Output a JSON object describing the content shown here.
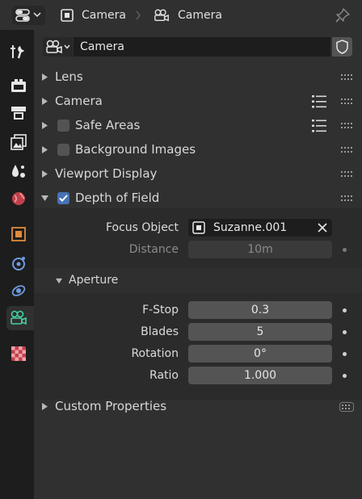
{
  "header": {
    "editor_type_icon": "properties-editor-icon",
    "breadcrumb": [
      {
        "icon": "object-icon",
        "label": "Camera"
      },
      {
        "icon": "camera-data-icon",
        "label": "Camera"
      }
    ],
    "pin_icon": "pin-icon"
  },
  "tabs": [
    {
      "icon": "tool-icon",
      "active": false
    },
    {
      "icon": "render-icon",
      "active": false
    },
    {
      "icon": "output-icon",
      "active": false
    },
    {
      "icon": "view-layer-icon",
      "active": false
    },
    {
      "icon": "scene-icon",
      "active": false
    },
    {
      "icon": "world-icon",
      "active": false
    },
    {
      "icon": "object-icon",
      "active": false
    },
    {
      "icon": "modifiers-icon",
      "active": false
    },
    {
      "icon": "physics-icon",
      "active": false
    },
    {
      "icon": "camera-data-icon",
      "active": true
    },
    {
      "icon": "texture-icon",
      "active": false
    }
  ],
  "datablock": {
    "type_icon": "camera-data-icon",
    "name": "Camera",
    "fake_user_icon": "shield-icon"
  },
  "sections": {
    "lens": "Lens",
    "camera": "Camera",
    "safe_areas": "Safe Areas",
    "background_images": "Background Images",
    "viewport_display": "Viewport Display",
    "depth_of_field": "Depth of Field",
    "custom_properties": "Custom Properties"
  },
  "checkboxes": {
    "safe_areas": false,
    "background_images": false,
    "depth_of_field": true
  },
  "dof": {
    "focus_object_label": "Focus Object",
    "focus_object_value": "Suzanne.001",
    "distance_label": "Distance",
    "distance_value": "10m",
    "aperture_label": "Aperture",
    "fstop_label": "F-Stop",
    "fstop_value": "0.3",
    "blades_label": "Blades",
    "blades_value": "5",
    "rotation_label": "Rotation",
    "rotation_value": "0°",
    "ratio_label": "Ratio",
    "ratio_value": "1.000"
  },
  "colors": {
    "background": "#303030",
    "tab_strip": "#1d1d1d",
    "checkbox_on": "#4772b3",
    "field": "#545454",
    "active_tab_icon": "#45d1a1"
  }
}
